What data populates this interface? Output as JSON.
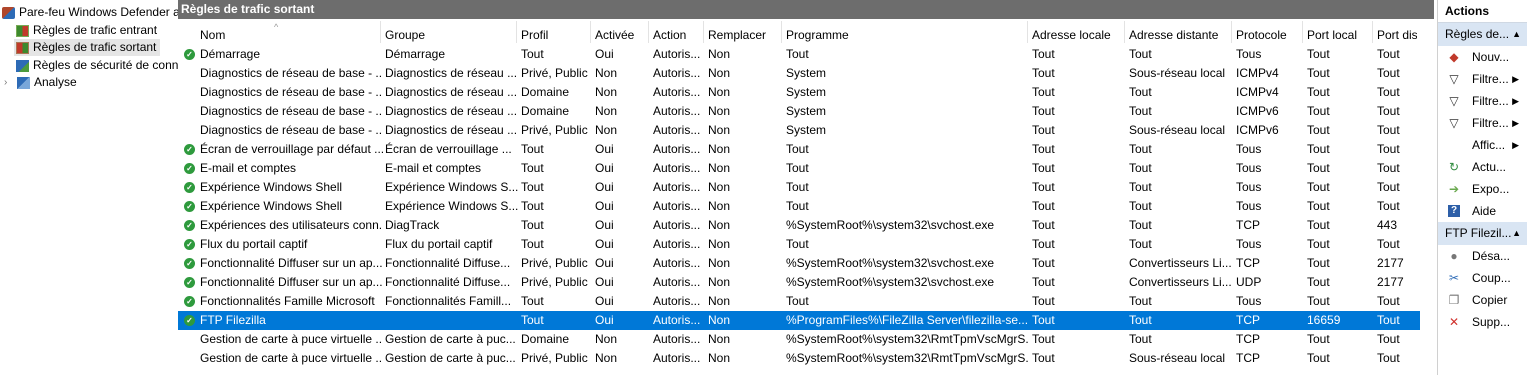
{
  "tree": {
    "items": [
      {
        "label": "Pare-feu Windows Defender a",
        "icon": "firewall-icon"
      },
      {
        "label": "Règles de trafic entrant",
        "icon": "inbound-rules-icon"
      },
      {
        "label": "Règles de trafic sortant",
        "icon": "outbound-rules-icon"
      },
      {
        "label": "Règles de sécurité de conn",
        "icon": "connection-security-icon"
      },
      {
        "label": "Analyse",
        "icon": "monitoring-icon"
      }
    ]
  },
  "main": {
    "title": "Règles de trafic sortant",
    "columns": [
      "Nom",
      "Groupe",
      "Profil",
      "Activée",
      "Action",
      "Remplacer",
      "Programme",
      "Adresse locale",
      "Adresse distante",
      "Protocole",
      "Port local",
      "Port dis"
    ],
    "rows": [
      {
        "enabled": true,
        "cells": [
          "Démarrage",
          "Démarrage",
          "Tout",
          "Oui",
          "Autoris...",
          "Non",
          "Tout",
          "Tout",
          "Tout",
          "Tous",
          "Tout",
          "Tout"
        ]
      },
      {
        "enabled": false,
        "cells": [
          "Diagnostics de réseau de base - ...",
          "Diagnostics de réseau ...",
          "Privé, Public",
          "Non",
          "Autoris...",
          "Non",
          "System",
          "Tout",
          "Sous-réseau local",
          "ICMPv4",
          "Tout",
          "Tout"
        ]
      },
      {
        "enabled": false,
        "cells": [
          "Diagnostics de réseau de base - ...",
          "Diagnostics de réseau ...",
          "Domaine",
          "Non",
          "Autoris...",
          "Non",
          "System",
          "Tout",
          "Tout",
          "ICMPv4",
          "Tout",
          "Tout"
        ]
      },
      {
        "enabled": false,
        "cells": [
          "Diagnostics de réseau de base - ...",
          "Diagnostics de réseau ...",
          "Domaine",
          "Non",
          "Autoris...",
          "Non",
          "System",
          "Tout",
          "Tout",
          "ICMPv6",
          "Tout",
          "Tout"
        ]
      },
      {
        "enabled": false,
        "cells": [
          "Diagnostics de réseau de base - ...",
          "Diagnostics de réseau ...",
          "Privé, Public",
          "Non",
          "Autoris...",
          "Non",
          "System",
          "Tout",
          "Sous-réseau local",
          "ICMPv6",
          "Tout",
          "Tout"
        ]
      },
      {
        "enabled": true,
        "cells": [
          "Écran de verrouillage par défaut ...",
          "Écran de verrouillage ...",
          "Tout",
          "Oui",
          "Autoris...",
          "Non",
          "Tout",
          "Tout",
          "Tout",
          "Tous",
          "Tout",
          "Tout"
        ]
      },
      {
        "enabled": true,
        "cells": [
          "E-mail et comptes",
          "E-mail et comptes",
          "Tout",
          "Oui",
          "Autoris...",
          "Non",
          "Tout",
          "Tout",
          "Tout",
          "Tous",
          "Tout",
          "Tout"
        ]
      },
      {
        "enabled": true,
        "cells": [
          "Expérience Windows Shell",
          "Expérience Windows S...",
          "Tout",
          "Oui",
          "Autoris...",
          "Non",
          "Tout",
          "Tout",
          "Tout",
          "Tous",
          "Tout",
          "Tout"
        ]
      },
      {
        "enabled": true,
        "cells": [
          "Expérience Windows Shell",
          "Expérience Windows S...",
          "Tout",
          "Oui",
          "Autoris...",
          "Non",
          "Tout",
          "Tout",
          "Tout",
          "Tous",
          "Tout",
          "Tout"
        ]
      },
      {
        "enabled": true,
        "cells": [
          "Expériences des utilisateurs conn...",
          "DiagTrack",
          "Tout",
          "Oui",
          "Autoris...",
          "Non",
          "%SystemRoot%\\system32\\svchost.exe",
          "Tout",
          "Tout",
          "TCP",
          "Tout",
          "443"
        ]
      },
      {
        "enabled": true,
        "cells": [
          "Flux du portail captif",
          "Flux du portail captif",
          "Tout",
          "Oui",
          "Autoris...",
          "Non",
          "Tout",
          "Tout",
          "Tout",
          "Tous",
          "Tout",
          "Tout"
        ]
      },
      {
        "enabled": true,
        "cells": [
          "Fonctionnalité Diffuser sur un ap...",
          "Fonctionnalité Diffuse...",
          "Privé, Public",
          "Oui",
          "Autoris...",
          "Non",
          "%SystemRoot%\\system32\\svchost.exe",
          "Tout",
          "Convertisseurs Li...",
          "TCP",
          "Tout",
          "2177"
        ]
      },
      {
        "enabled": true,
        "cells": [
          "Fonctionnalité Diffuser sur un ap...",
          "Fonctionnalité Diffuse...",
          "Privé, Public",
          "Oui",
          "Autoris...",
          "Non",
          "%SystemRoot%\\system32\\svchost.exe",
          "Tout",
          "Convertisseurs Li...",
          "UDP",
          "Tout",
          "2177"
        ]
      },
      {
        "enabled": true,
        "cells": [
          "Fonctionnalités Famille Microsoft",
          "Fonctionnalités Famill...",
          "Tout",
          "Oui",
          "Autoris...",
          "Non",
          "Tout",
          "Tout",
          "Tout",
          "Tous",
          "Tout",
          "Tout"
        ]
      },
      {
        "enabled": true,
        "selected": true,
        "cells": [
          "FTP Filezilla",
          "",
          "Tout",
          "Oui",
          "Autoris...",
          "Non",
          "%ProgramFiles%\\FileZilla Server\\filezilla-se...",
          "Tout",
          "Tout",
          "TCP",
          "16659",
          "Tout"
        ]
      },
      {
        "enabled": false,
        "cells": [
          "Gestion de carte à puce virtuelle ...",
          "Gestion de carte à puc...",
          "Domaine",
          "Non",
          "Autoris...",
          "Non",
          "%SystemRoot%\\system32\\RmtTpmVscMgrS...",
          "Tout",
          "Tout",
          "TCP",
          "Tout",
          "Tout"
        ]
      },
      {
        "enabled": false,
        "cells": [
          "Gestion de carte à puce virtuelle ...",
          "Gestion de carte à puc...",
          "Privé, Public",
          "Non",
          "Autoris...",
          "Non",
          "%SystemRoot%\\system32\\RmtTpmVscMgrS...",
          "Tout",
          "Sous-réseau local",
          "TCP",
          "Tout",
          "Tout"
        ]
      }
    ]
  },
  "actions": {
    "title": "Actions",
    "group1": "Règles de...",
    "group1_items": [
      {
        "label": "Nouv...",
        "icon": "new-rule-icon",
        "submenu": false
      },
      {
        "label": "Filtre...",
        "icon": "filter-icon",
        "submenu": true
      },
      {
        "label": "Filtre...",
        "icon": "filter-icon",
        "submenu": true
      },
      {
        "label": "Filtre...",
        "icon": "filter-icon",
        "submenu": true
      },
      {
        "label": "Affic...",
        "icon": "",
        "submenu": true
      },
      {
        "label": "Actu...",
        "icon": "refresh-icon",
        "submenu": false
      },
      {
        "label": "Expo...",
        "icon": "export-icon",
        "submenu": false
      },
      {
        "label": "Aide",
        "icon": "help-icon",
        "submenu": false
      }
    ],
    "group2": "FTP Filezil...",
    "group2_items": [
      {
        "label": "Désa...",
        "icon": "disable-icon"
      },
      {
        "label": "Coup...",
        "icon": "cut-icon"
      },
      {
        "label": "Copier",
        "icon": "copy-icon"
      },
      {
        "label": "Supp...",
        "icon": "delete-icon"
      }
    ]
  }
}
